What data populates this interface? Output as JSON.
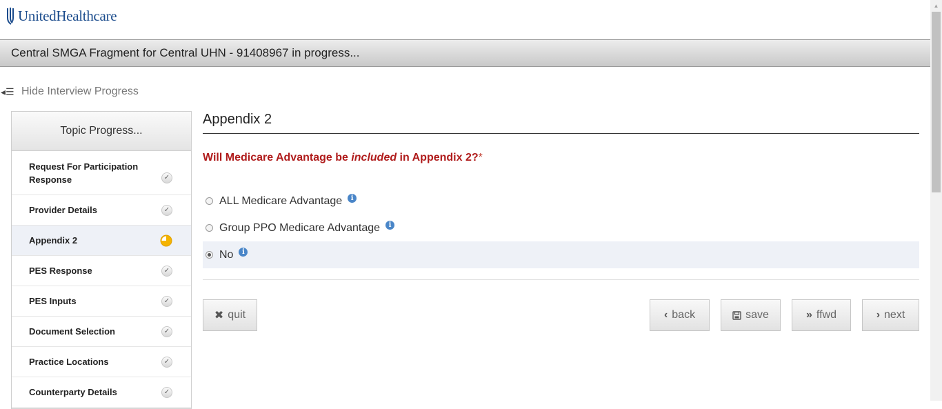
{
  "brand": {
    "logo_text": "UnitedHealthcare"
  },
  "titlebar": {
    "text": "Central SMGA Fragment for Central UHN - 91408967 in progress..."
  },
  "toggle": {
    "label": "Hide Interview Progress"
  },
  "sidebar": {
    "header": "Topic Progress...",
    "items": [
      {
        "label": "Request For Participation Response",
        "status": "complete"
      },
      {
        "label": "Provider Details",
        "status": "complete"
      },
      {
        "label": "Appendix 2",
        "status": "in-progress"
      },
      {
        "label": "PES Response",
        "status": "complete"
      },
      {
        "label": "PES Inputs",
        "status": "complete"
      },
      {
        "label": "Document Selection",
        "status": "complete"
      },
      {
        "label": "Practice Locations",
        "status": "complete"
      },
      {
        "label": "Counterparty Details",
        "status": "complete"
      }
    ]
  },
  "main": {
    "title": "Appendix 2",
    "question": {
      "before": "Will Medicare Advantage be ",
      "emph": "included",
      "after": " in Appendix 2?",
      "required": "*"
    },
    "options": [
      {
        "label": "ALL Medicare Advantage",
        "selected": false
      },
      {
        "label": "Group PPO Medicare Advantage",
        "selected": false
      },
      {
        "label": "No",
        "selected": true
      }
    ]
  },
  "buttons": {
    "quit": "quit",
    "back": "back",
    "save": "save",
    "ffwd": "ffwd",
    "next": "next"
  },
  "colors": {
    "question": "#b01c1c",
    "brand": "#1a4b8c",
    "selected_row": "#eef1f7",
    "progress": "#f5b400"
  },
  "icons": {
    "toggle": "list-collapse-icon",
    "status_complete": "check-icon",
    "status_in_progress": "pie-progress-icon",
    "info": "info-icon",
    "quit": "close-icon",
    "back": "chevron-left-icon",
    "save": "floppy-disk-icon",
    "ffwd": "double-chevron-right-icon",
    "next": "chevron-right-icon"
  }
}
